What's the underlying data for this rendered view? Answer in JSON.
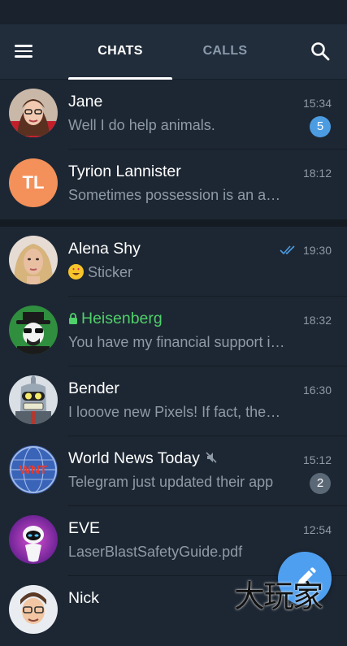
{
  "header": {
    "tabs": [
      {
        "label": "CHATS",
        "active": true
      },
      {
        "label": "CALLS",
        "active": false
      }
    ]
  },
  "chats": [
    {
      "name": "Jane",
      "message": "Well I do help animals.",
      "time": "15:34",
      "unread": "5",
      "avatar": "jane-avatar"
    },
    {
      "name": "Tyrion Lannister",
      "initials": "TL",
      "message": "Sometimes possession is an abstract concept",
      "time": "18:12",
      "avatar_color": "#f4905a"
    },
    {
      "name": "Alena Shy",
      "message": "Sticker",
      "time": "19:30",
      "status": "read",
      "avatar": "alena-avatar"
    },
    {
      "name": "Heisenberg",
      "message": "You have my financial support if you need it",
      "time": "18:32",
      "secret": true,
      "avatar": "heisenberg-avatar"
    },
    {
      "name": "Bender",
      "message": "I looove new Pixels! If fact, they are so good",
      "time": "16:30",
      "avatar": "bender-avatar"
    },
    {
      "name": "World News Today",
      "message": "Telegram just updated their app",
      "time": "15:12",
      "unread": "2",
      "muted": true,
      "avatar": "world-news-avatar"
    },
    {
      "name": "EVE",
      "message": "LaserBlastSafetyGuide.pdf",
      "time": "12:54",
      "avatar": "eve-avatar"
    },
    {
      "name": "Nick",
      "message": "",
      "time": "",
      "avatar": "nick-avatar"
    }
  ],
  "watermark": "大玩家",
  "colors": {
    "background": "#1d2733",
    "header": "#212d3b",
    "accent": "#4c9ce2",
    "secret_green": "#4fd06a",
    "fab": "#4f9ff0"
  }
}
